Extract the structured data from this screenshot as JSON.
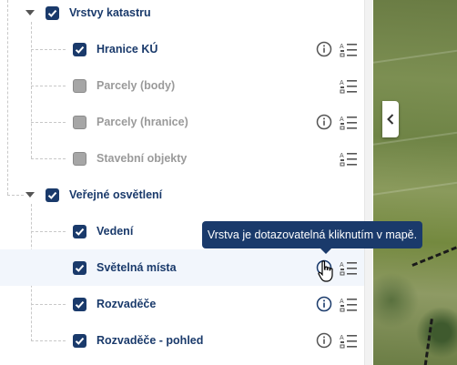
{
  "groups": [
    {
      "label": "Vrstvy katastru"
    },
    {
      "label": "Veřejné osvětlení"
    }
  ],
  "layers": [
    {
      "label": "Hranice KÚ"
    },
    {
      "label": "Parcely (body)"
    },
    {
      "label": "Parcely (hranice)"
    },
    {
      "label": "Stavební objekty"
    },
    {
      "label": "Vedení"
    },
    {
      "label": "Světelná místa"
    },
    {
      "label": "Rozvaděče"
    },
    {
      "label": "Rozvaděče - pohled"
    }
  ],
  "tooltip": {
    "text": "Vrstva je dotazovatelná kliknutím v mapě."
  },
  "colors": {
    "accent": "#1a3a6b",
    "disabled": "#9a9a9a",
    "highlight_row": "#f2f6fc"
  },
  "icons": {
    "info": "info-circle-icon",
    "legend": "legend-list-icon",
    "collapse": "chevron-left-icon",
    "expand": "caret-down-icon"
  }
}
